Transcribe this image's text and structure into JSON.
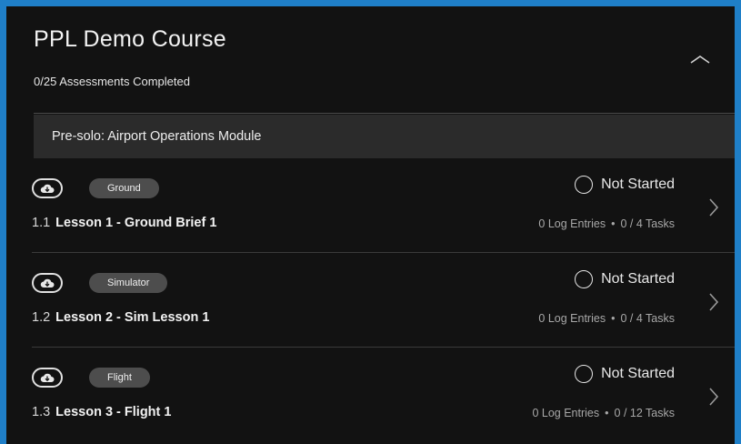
{
  "course": {
    "title": "PPL Demo Course",
    "progress": "0/25 Assessments Completed"
  },
  "module": {
    "title": "Pre-solo: Airport Operations Module"
  },
  "lessons": [
    {
      "type": "Ground",
      "number": "1.1",
      "title": "Lesson 1 - Ground Brief 1",
      "status": "Not Started",
      "log_entries": "0 Log Entries",
      "separator": "•",
      "tasks": "0 / 4 Tasks"
    },
    {
      "type": "Simulator",
      "number": "1.2",
      "title": "Lesson 2 - Sim Lesson 1",
      "status": "Not Started",
      "log_entries": "0 Log Entries",
      "separator": "•",
      "tasks": "0 / 4 Tasks"
    },
    {
      "type": "Flight",
      "number": "1.3",
      "title": "Lesson 3 - Flight 1",
      "status": "Not Started",
      "log_entries": "0 Log Entries",
      "separator": "•",
      "tasks": "0 / 12 Tasks"
    }
  ],
  "icons": {
    "collapse": "chevron-up-icon",
    "download": "cloud-download-icon",
    "status": "empty-circle-icon",
    "open": "chevron-right-icon"
  },
  "colors": {
    "border": "#1f7fc8",
    "background": "#121212",
    "module_bar": "#2b2b2b",
    "chip": "#4d4d4d"
  }
}
